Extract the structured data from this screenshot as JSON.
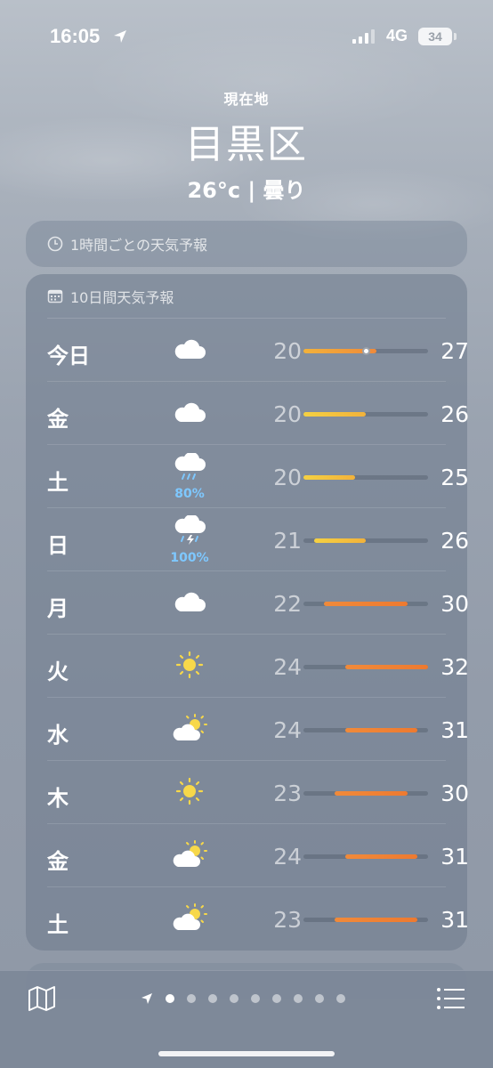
{
  "status_bar": {
    "time": "16:05",
    "network": "4G",
    "battery": "34"
  },
  "header": {
    "location_label": "現在地",
    "city": "目黒区",
    "condition": "26°c | 曇り"
  },
  "hourly_card": {
    "title": "1時間ごとの天気予報"
  },
  "ten_day": {
    "title": "10日間天気予報",
    "days": [
      {
        "day": "今日",
        "icon": "cloud-icon",
        "precip": "",
        "low": "20",
        "high": "27",
        "range": [
          20,
          27
        ],
        "current": 26
      },
      {
        "day": "金",
        "icon": "cloud-icon",
        "precip": "",
        "low": "20",
        "high": "26",
        "range": [
          20,
          26
        ]
      },
      {
        "day": "土",
        "icon": "cloud-rain-icon",
        "precip": "80%",
        "low": "20",
        "high": "25",
        "range": [
          20,
          25
        ]
      },
      {
        "day": "日",
        "icon": "cloud-thunder-icon",
        "precip": "100%",
        "low": "21",
        "high": "26",
        "range": [
          21,
          26
        ]
      },
      {
        "day": "月",
        "icon": "cloud-icon",
        "precip": "",
        "low": "22",
        "high": "30",
        "range": [
          22,
          30
        ]
      },
      {
        "day": "火",
        "icon": "sun-icon",
        "precip": "",
        "low": "24",
        "high": "32",
        "range": [
          24,
          32
        ]
      },
      {
        "day": "水",
        "icon": "partly-cloudy-icon",
        "precip": "",
        "low": "24",
        "high": "31",
        "range": [
          24,
          31
        ]
      },
      {
        "day": "木",
        "icon": "sun-icon",
        "precip": "",
        "low": "23",
        "high": "30",
        "range": [
          23,
          30
        ]
      },
      {
        "day": "金",
        "icon": "partly-cloudy-icon",
        "precip": "",
        "low": "24",
        "high": "31",
        "range": [
          24,
          31
        ]
      },
      {
        "day": "土",
        "icon": "partly-cloudy-icon",
        "precip": "",
        "low": "23",
        "high": "31",
        "range": [
          23,
          31
        ]
      }
    ],
    "scale_min": 20,
    "scale_max": 32
  },
  "toolbar": {
    "page_count": 9,
    "active_page": 0
  },
  "colors": {
    "cool": "#f5d142",
    "warm": "#f08a3a",
    "precip": "#7ec8ff"
  }
}
